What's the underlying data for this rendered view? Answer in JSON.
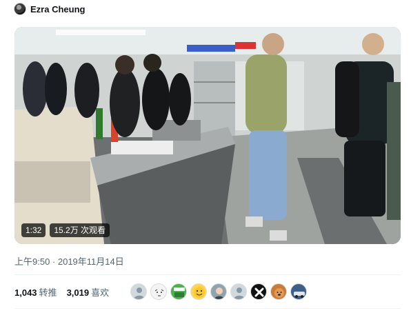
{
  "tweet": {
    "author_name": "Ezra Cheung",
    "avatar_icon": "profile-avatar"
  },
  "video": {
    "duration": "1:32",
    "view_count": "15.2万 次观看"
  },
  "timestamp": "上午9:50 · 2019年11月14日",
  "stats": {
    "retweets_count": "1,043",
    "retweets_label": "转推",
    "likes_count": "3,019",
    "likes_label": "喜欢"
  },
  "likers": [
    {
      "icon": "default-user-avatar",
      "color": "#cfd9de"
    },
    {
      "icon": "sketch-face-avatar",
      "color": "#f4f4f4"
    },
    {
      "icon": "sticker-avatar",
      "color": "#4caf50"
    },
    {
      "icon": "emoji-avatar",
      "color": "#ffd54f"
    },
    {
      "icon": "anime-avatar",
      "color": "#90a4ae"
    },
    {
      "icon": "default-user-avatar",
      "color": "#cfd9de"
    },
    {
      "icon": "x-mark-avatar",
      "color": "#111111"
    },
    {
      "icon": "dog-avatar",
      "color": "#c97b3a"
    },
    {
      "icon": "car-avatar",
      "color": "#3f5f8a"
    }
  ]
}
